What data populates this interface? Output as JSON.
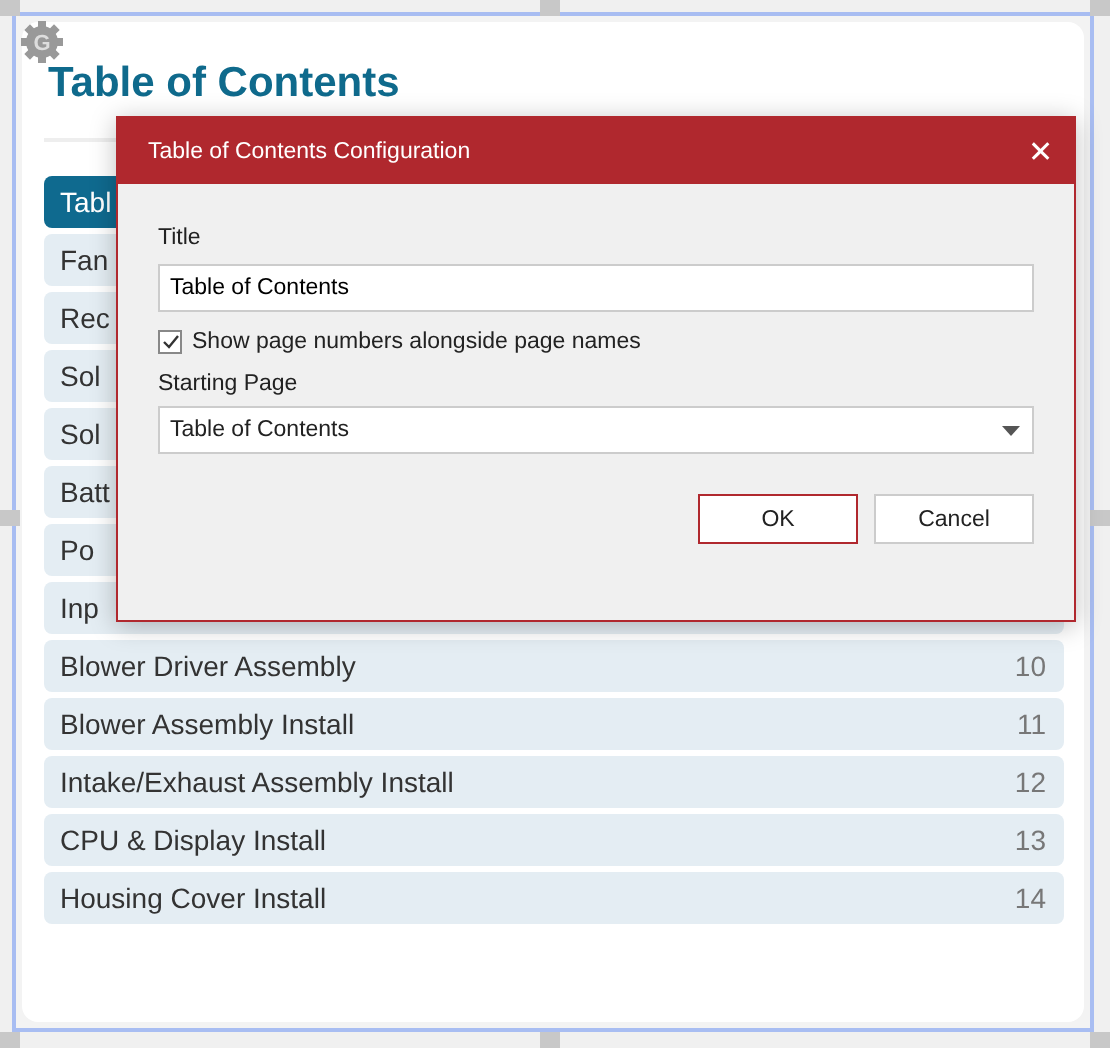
{
  "app_icon": {
    "letter": "G"
  },
  "page": {
    "title": "Table of Contents",
    "entries": [
      {
        "name": "Tabl",
        "selected": true
      },
      {
        "name": "Fan",
        "selected": false
      },
      {
        "name": "Rec",
        "selected": false
      },
      {
        "name": "Sol",
        "selected": false
      },
      {
        "name": "Sol",
        "selected": false
      },
      {
        "name": "Batt",
        "selected": false
      },
      {
        "name": "Po",
        "selected": false
      },
      {
        "name": "Inp",
        "selected": false
      },
      {
        "name": "Blower Driver Assembly",
        "page": "10",
        "selected": false
      },
      {
        "name": "Blower Assembly Install",
        "page": "11",
        "selected": false
      },
      {
        "name": "Intake/Exhaust Assembly Install",
        "page": "12",
        "selected": false
      },
      {
        "name": "CPU & Display Install",
        "page": "13",
        "selected": false
      },
      {
        "name": "Housing Cover Install",
        "page": "14",
        "selected": false
      }
    ]
  },
  "dialog": {
    "title": "Table of Contents Configuration",
    "close": "✕",
    "title_label": "Title",
    "title_value": "Table of Contents",
    "show_page_numbers": {
      "label": "Show page numbers alongside page names",
      "checked": true
    },
    "starting_page_label": "Starting Page",
    "starting_page_value": "Table of Contents",
    "buttons": [
      {
        "label": "OK",
        "kind": "primary"
      },
      {
        "label": "Cancel",
        "kind": "secondary"
      }
    ]
  }
}
